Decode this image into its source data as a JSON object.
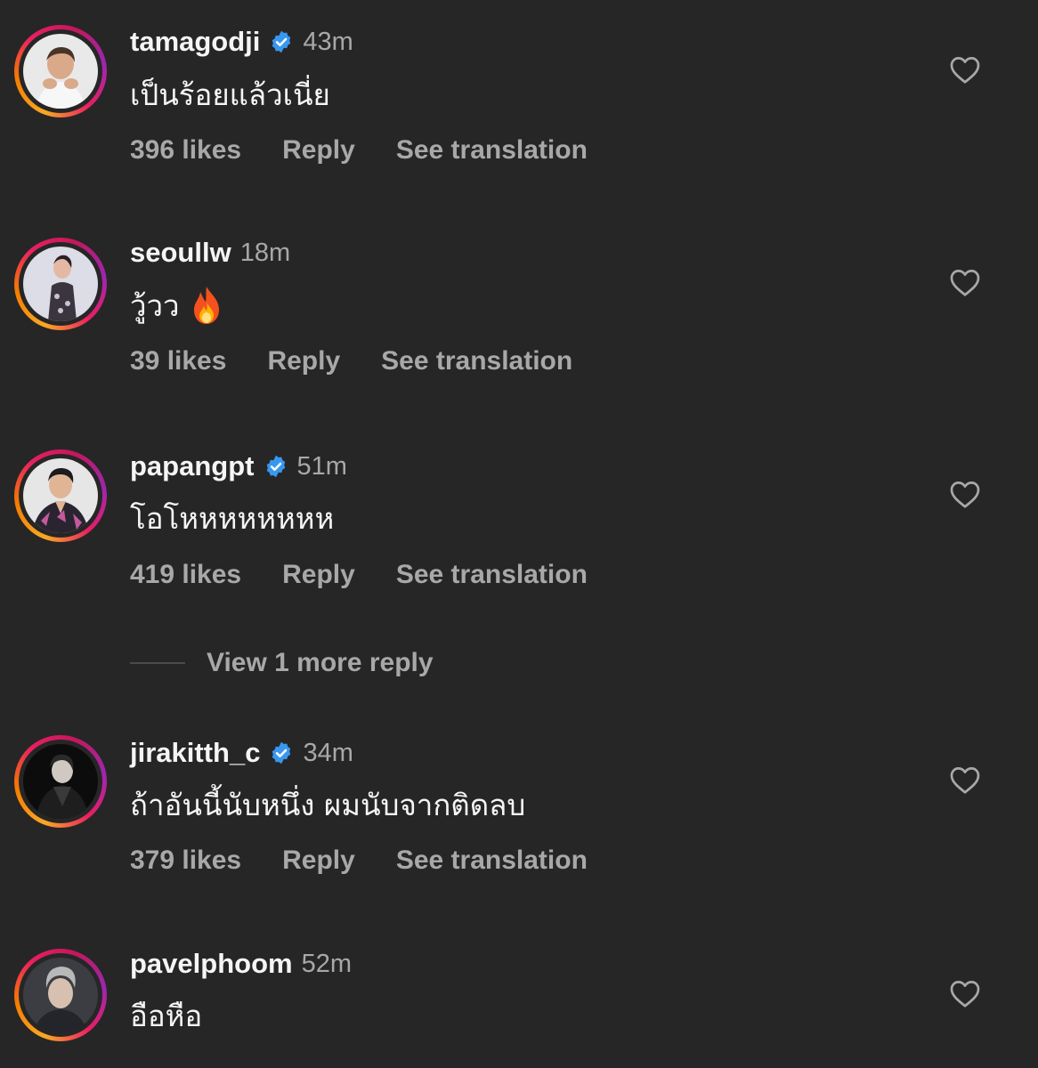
{
  "comments": [
    {
      "username": "tamagodji",
      "verified": true,
      "time": "43m",
      "text": "เป็นร้อยแล้วเนี่ย",
      "likes": "396 likes",
      "reply": "Reply",
      "translate": "See translation"
    },
    {
      "username": "seoullw",
      "verified": false,
      "time": "18m",
      "text": "วู้วว",
      "emoji": "fire-emoji",
      "likes": "39 likes",
      "reply": "Reply",
      "translate": "See translation"
    },
    {
      "username": "papangpt",
      "verified": true,
      "time": "51m",
      "text": "โอโหหหหหหหห",
      "likes": "419 likes",
      "reply": "Reply",
      "translate": "See translation"
    },
    {
      "username": "jirakitth_c",
      "verified": true,
      "time": "34m",
      "text": "ถ้าอันนี้นับหนึ่ง ผมนับจากติดลบ",
      "likes": "379 likes",
      "reply": "Reply",
      "translate": "See translation"
    },
    {
      "username": "pavelphoom",
      "verified": false,
      "time": "52m",
      "text": "อือหือ"
    }
  ],
  "view_more_replies": "View 1 more reply",
  "icons": {
    "verified": "verified-badge-icon",
    "heart": "heart-outline-icon"
  },
  "colors": {
    "background": "#262626",
    "primary_text": "#f5f5f5",
    "secondary_text": "#a8a8a8",
    "verified_blue": "#3897f0"
  }
}
